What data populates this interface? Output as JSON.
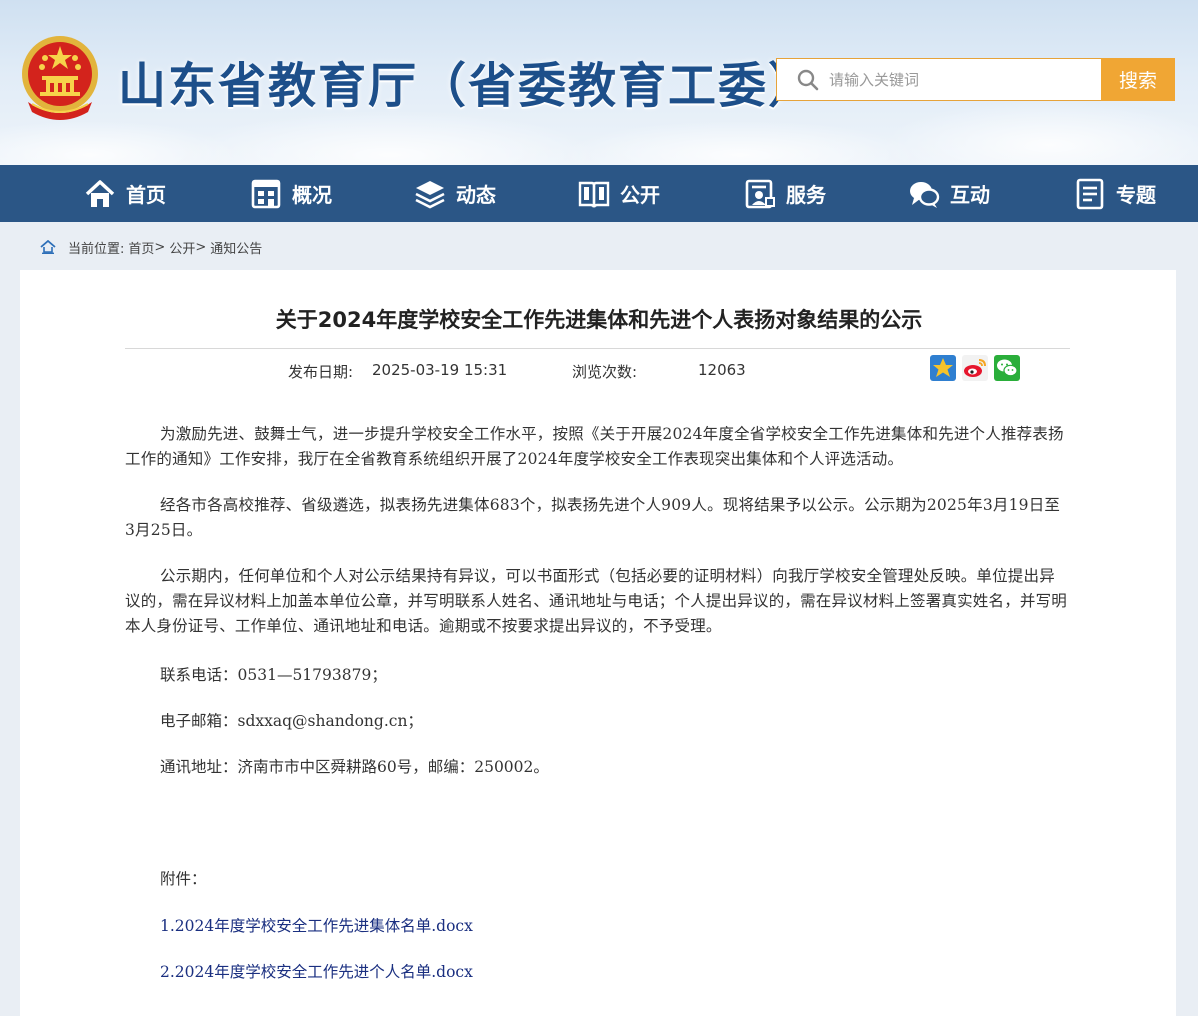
{
  "header": {
    "site_title": "山东省教育厅（省委教育工委）",
    "search_placeholder": "请输入关键词",
    "search_button": "搜索"
  },
  "nav": {
    "items": [
      {
        "label": "首页",
        "icon": "home-icon"
      },
      {
        "label": "概况",
        "icon": "building-icon"
      },
      {
        "label": "动态",
        "icon": "layers-icon"
      },
      {
        "label": "公开",
        "icon": "book-icon"
      },
      {
        "label": "服务",
        "icon": "service-icon"
      },
      {
        "label": "互动",
        "icon": "chat-icon"
      },
      {
        "label": "专题",
        "icon": "document-icon"
      }
    ]
  },
  "breadcrumb": {
    "prefix": "当前位置:",
    "items": [
      "首页",
      "公开",
      "通知公告"
    ],
    "separator": ">"
  },
  "article": {
    "title": "关于2024年度学校安全工作先进集体和先进个人表扬对象结果的公示",
    "publish_label": "发布日期:",
    "publish_date": "2025-03-19 15:31",
    "views_label": "浏览次数:",
    "views": "12063",
    "share_icons": [
      "qzone-icon",
      "weibo-icon",
      "wechat-icon"
    ],
    "paragraphs": [
      "为激励先进、鼓舞士气，进一步提升学校安全工作水平，按照《关于开展2024年度全省学校安全工作先进集体和先进个人推荐表扬工作的通知》工作安排，我厅在全省教育系统组织开展了2024年度学校安全工作表现突出集体和个人评选活动。",
      "经各市各高校推荐、省级遴选，拟表扬先进集体683个，拟表扬先进个人909人。现将结果予以公示。公示期为2025年3月19日至3月25日。",
      "公示期内，任何单位和个人对公示结果持有异议，可以书面形式（包括必要的证明材料）向我厅学校安全管理处反映。单位提出异议的，需在异议材料上加盖本单位公章，并写明联系人姓名、通讯地址与电话；个人提出异议的，需在异议材料上签署真实姓名，并写明本人身份证号、工作单位、通讯地址和电话。逾期或不按要求提出异议的，不予受理。"
    ],
    "contact_phone": "联系电话：0531—51793879；",
    "contact_email": "电子邮箱：sdxxaq@shandong.cn；",
    "contact_address": "通讯地址：济南市市中区舜耕路60号，邮编：250002。",
    "attachments_label": "附件：",
    "attachments": [
      "1.2024年度学校安全工作先进集体名单.docx",
      "2.2024年度学校安全工作先进个人名单.docx"
    ]
  }
}
